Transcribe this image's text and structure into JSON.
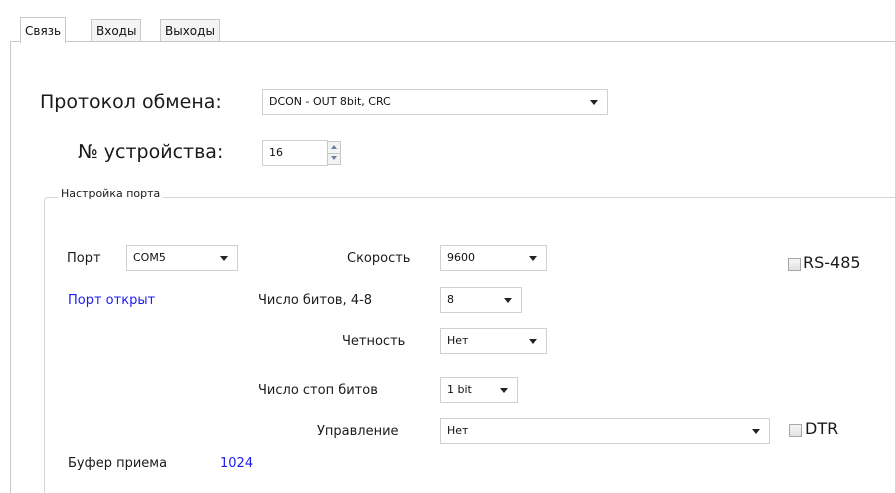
{
  "tabs": [
    {
      "label": "Связь",
      "active": true
    },
    {
      "label": "Входы",
      "active": false
    },
    {
      "label": "Выходы",
      "active": false
    }
  ],
  "protocol": {
    "label": "Протокол обмена:",
    "value": "DCON - OUT 8bit, CRC"
  },
  "device": {
    "label": "№ устройства:",
    "value": "16"
  },
  "port_group": {
    "title": "Настройка порта",
    "port": {
      "label": "Порт",
      "value": "COM5"
    },
    "status": {
      "text": "Порт открыт",
      "color": "#1c1cf0"
    },
    "speed": {
      "label": "Скорость",
      "value": "9600"
    },
    "bits": {
      "label": "Число битов, 4-8",
      "value": "8"
    },
    "parity": {
      "label": "Четность",
      "value": "Нет"
    },
    "stop_bits": {
      "label": "Число стоп битов",
      "value": "1 bit"
    },
    "control": {
      "label": "Управление",
      "value": "Нет"
    },
    "rs485": {
      "label": "RS-485",
      "checked": false
    },
    "dtr": {
      "label": "DTR",
      "checked": false
    },
    "buffer": {
      "label": "Буфер приема",
      "value": "1024"
    }
  }
}
